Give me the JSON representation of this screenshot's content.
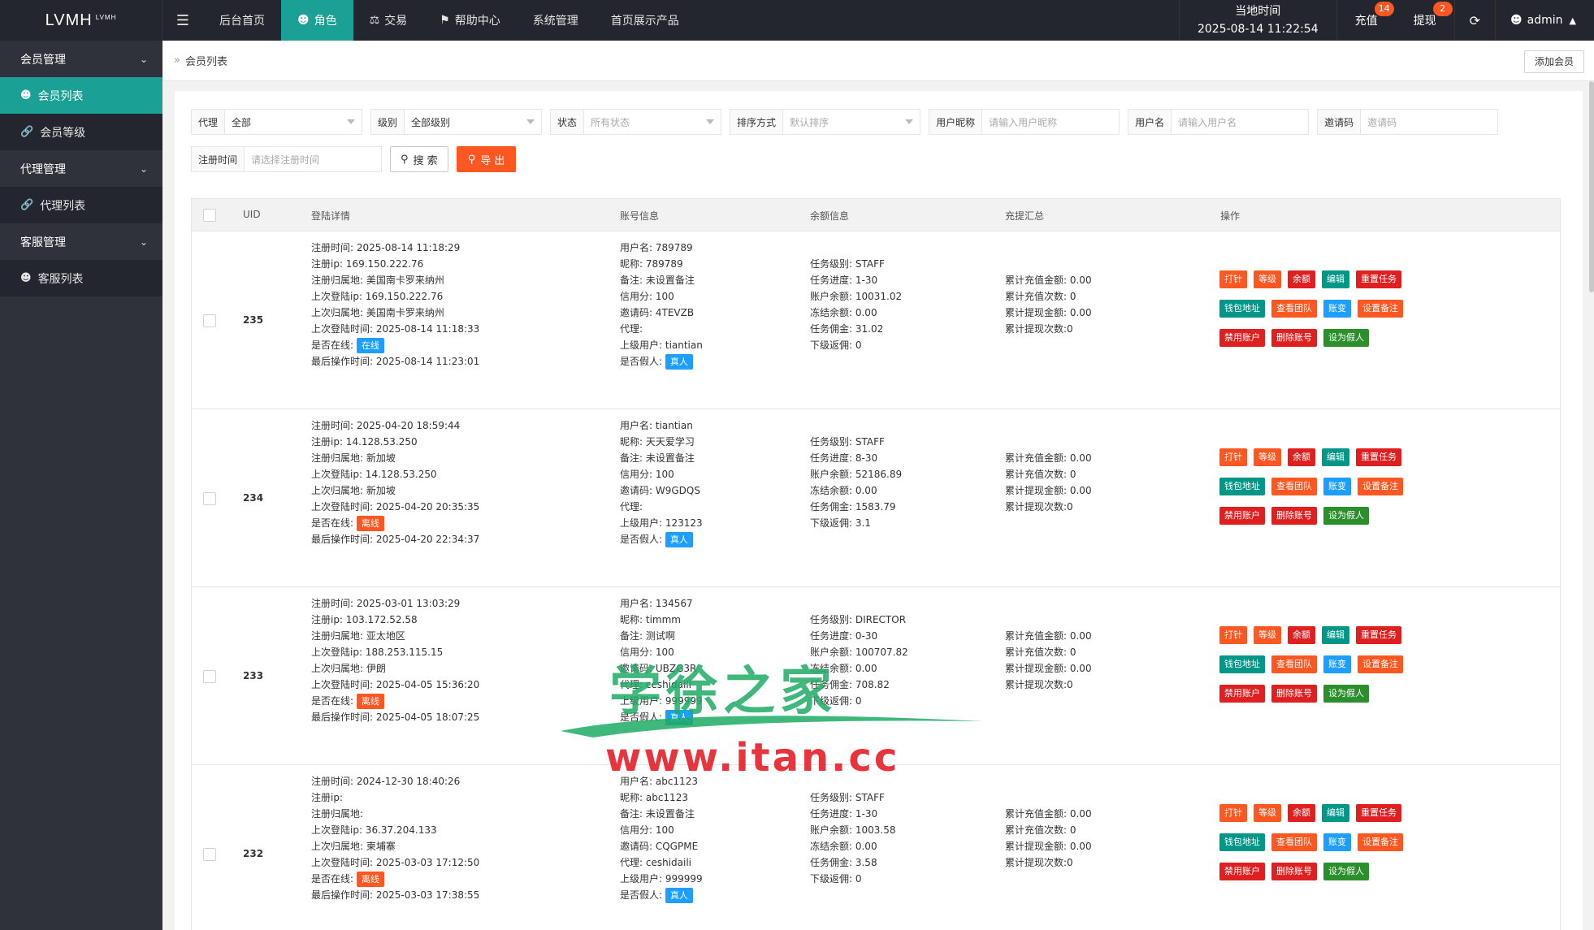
{
  "app": {
    "logo": "LVMH",
    "logo_sup": "LVMH"
  },
  "topnav": {
    "items": [
      "后台首页",
      "角色",
      "交易",
      "帮助中心",
      "系统管理",
      "首页展示产品"
    ],
    "time_label": "当地时间",
    "time_value": "2025-08-14 11:22:54",
    "recharge_label": "充值",
    "recharge_count": "14",
    "withdraw_label": "提现",
    "withdraw_count": "2",
    "user": "admin"
  },
  "sidebar": {
    "groups": [
      "会员管理",
      "代理管理",
      "客服管理"
    ],
    "items": [
      "会员列表",
      "会员等级",
      "代理列表",
      "客服列表"
    ]
  },
  "breadcrumb": {
    "current": "会员列表",
    "add_button": "添加会员"
  },
  "filters": {
    "agent_label": "代理",
    "agent_value": "全部",
    "level_label": "级别",
    "level_value": "全部级别",
    "status_label": "状态",
    "status_value": "所有状态",
    "sort_label": "排序方式",
    "sort_value": "默认排序",
    "nick_label": "用户昵称",
    "nick_ph": "请输入用户昵称",
    "user_label": "用户名",
    "user_ph": "请输入用户名",
    "invite_label": "邀请码",
    "invite_ph": "邀请码",
    "regtime_label": "注册时间",
    "regtime_ph": "请选择注册时间",
    "search_btn": "搜 索",
    "export_btn": "导 出"
  },
  "table": {
    "headers": [
      "UID",
      "登陆详情",
      "账号信息",
      "余额信息",
      "充提汇总",
      "操作"
    ],
    "ops": [
      "打针",
      "等级",
      "余额",
      "编辑",
      "重置任务",
      "钱包地址",
      "查看团队",
      "账变",
      "设置备注",
      "禁用账户",
      "删除账号",
      "设为假人"
    ],
    "rows": [
      {
        "uid": "235",
        "login": [
          "注册时间:  2025-08-14 11:18:29",
          "注册ip: 169.150.222.76",
          "注册归属地: 美国南卡罗来纳州",
          "上次登陆ip: 169.150.222.76",
          "上次归属地: 美国南卡罗来纳州",
          "上次登陆时间: 2025-08-14 11:18:33",
          "是否在线:",
          "最后操作时间: 2025-08-14 11:23:01"
        ],
        "online": "在线",
        "online_state": "online",
        "account": [
          "用户名: 789789",
          "昵称: 789789",
          "备注: 未设置备注",
          "信用分: 100",
          "邀请码: 4TEVZB",
          "代理:",
          "上级用户: tiantian",
          "是否假人:"
        ],
        "fake": "真人",
        "balance": [
          "任务级别: STAFF",
          "任务进度: 1-30",
          "账户余额: 10031.02",
          "冻结余额: 0.00",
          "任务佣金: 31.02",
          "下级返佣: 0"
        ],
        "summary": [
          "累计充值金额: 0.00",
          "累计充值次数: 0",
          "累计提现金额: 0.00",
          "累计提现次数:0"
        ]
      },
      {
        "uid": "234",
        "login": [
          "注册时间:  2025-04-20 18:59:44",
          "注册ip: 14.128.53.250",
          "注册归属地: 新加坡",
          "上次登陆ip: 14.128.53.250",
          "上次归属地: 新加坡",
          "上次登陆时间: 2025-04-20 20:35:35",
          "是否在线:",
          "最后操作时间: 2025-04-20 22:34:37"
        ],
        "online": "离线",
        "online_state": "offline",
        "account": [
          "用户名: tiantian",
          "昵称: 天天爱学习",
          "备注: 未设置备注",
          "信用分: 100",
          "邀请码: W9GDQS",
          "代理:",
          "上级用户: 123123",
          "是否假人:"
        ],
        "fake": "真人",
        "balance": [
          "任务级别: STAFF",
          "任务进度: 8-30",
          "账户余额: 52186.89",
          "冻结余额: 0.00",
          "任务佣金: 1583.79",
          "下级返佣: 3.1"
        ],
        "summary": [
          "累计充值金额: 0.00",
          "累计充值次数: 0",
          "累计提现金额: 0.00",
          "累计提现次数:0"
        ]
      },
      {
        "uid": "233",
        "login": [
          "注册时间:  2025-03-01 13:03:29",
          "注册ip: 103.172.52.58",
          "注册归属地: 亚太地区",
          "上次登陆ip: 188.253.115.15",
          "上次归属地: 伊朗",
          "上次登陆时间: 2025-04-05 15:36:20",
          "是否在线:",
          "最后操作时间: 2025-04-05 18:07:25"
        ],
        "online": "离线",
        "online_state": "offline",
        "account": [
          "用户名: 134567",
          "昵称: timmm",
          "备注: 测试啊",
          "信用分: 100",
          "邀请码: UBZG3R",
          "代理: ceshidaili",
          "上级用户: 999999",
          "是否假人:"
        ],
        "fake": "真人",
        "balance": [
          "任务级别: DIRECTOR",
          "任务进度: 0-30",
          "账户余额: 100707.82",
          "冻结余额: 0.00",
          "任务佣金: 708.82",
          "下级返佣: 0"
        ],
        "summary": [
          "累计充值金额: 0.00",
          "累计充值次数: 0",
          "累计提现金额: 0.00",
          "累计提现次数:0"
        ]
      },
      {
        "uid": "232",
        "login": [
          "注册时间:  2024-12-30 18:40:26",
          "注册ip:",
          "注册归属地:",
          "上次登陆ip: 36.37.204.133",
          "上次归属地: 柬埔寨",
          "上次登陆时间: 2025-03-03 17:12:50",
          "是否在线:",
          "最后操作时间: 2025-03-03 17:38:55"
        ],
        "online": "离线",
        "online_state": "offline",
        "account": [
          "用户名: abc1123",
          "昵称: abc1123",
          "备注: 未设置备注",
          "信用分: 100",
          "邀请码: CQGPME",
          "代理: ceshidaili",
          "上级用户: 999999",
          "是否假人:"
        ],
        "fake": "真人",
        "balance": [
          "任务级别: STAFF",
          "任务进度: 1-30",
          "账户余额: 1003.58",
          "冻结余额: 0.00",
          "任务佣金: 3.58",
          "下级返佣: 0"
        ],
        "summary": [
          "累计充值金额: 0.00",
          "累计充值次数: 0",
          "累计提现金额: 0.00",
          "累计提现次数:0"
        ]
      }
    ]
  },
  "watermark": {
    "top": "学徐之家",
    "url": "www.itan.cc"
  }
}
